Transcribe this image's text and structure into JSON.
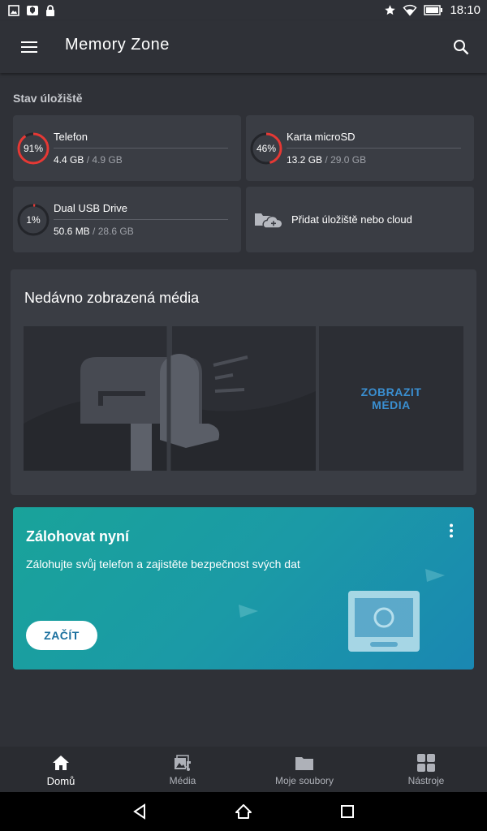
{
  "status_bar": {
    "time": "18:10"
  },
  "app_bar": {
    "title": "Memory Zone"
  },
  "storage": {
    "section_title": "Stav úložiště",
    "items": [
      {
        "name": "Telefon",
        "percent_label": "91%",
        "fraction": 0.91,
        "used": "4.4 GB",
        "separator": "/",
        "total": "4.9 GB"
      },
      {
        "name": "Karta microSD",
        "percent_label": "46%",
        "fraction": 0.46,
        "used": "13.2 GB",
        "separator": "/",
        "total": "29.0 GB"
      },
      {
        "name": "Dual USB Drive",
        "percent_label": "1%",
        "fraction": 0.01,
        "used": "50.6 MB",
        "separator": "/",
        "total": "28.6 GB"
      }
    ],
    "add_label": "Přidat úložiště nebo cloud"
  },
  "media": {
    "title": "Nedávno zobrazená média",
    "view_line1": "ZOBRAZIT",
    "view_line2": "MÉDIA"
  },
  "backup": {
    "title": "Zálohovat nyní",
    "description": "Zálohujte svůj telefon a zajistěte bezpečnost svých dat",
    "start_label": "ZAČÍT"
  },
  "bottom_nav": [
    {
      "label": "Domů",
      "icon": "home-icon",
      "active": true
    },
    {
      "label": "Média",
      "icon": "media-icon",
      "active": false
    },
    {
      "label": "Moje soubory",
      "icon": "folder-icon",
      "active": false
    },
    {
      "label": "Nástroje",
      "icon": "tools-icon",
      "active": false
    }
  ],
  "colors": {
    "ring_used": "#e53935",
    "ring_track": "#23252a",
    "accent": "#3a8fd1"
  }
}
